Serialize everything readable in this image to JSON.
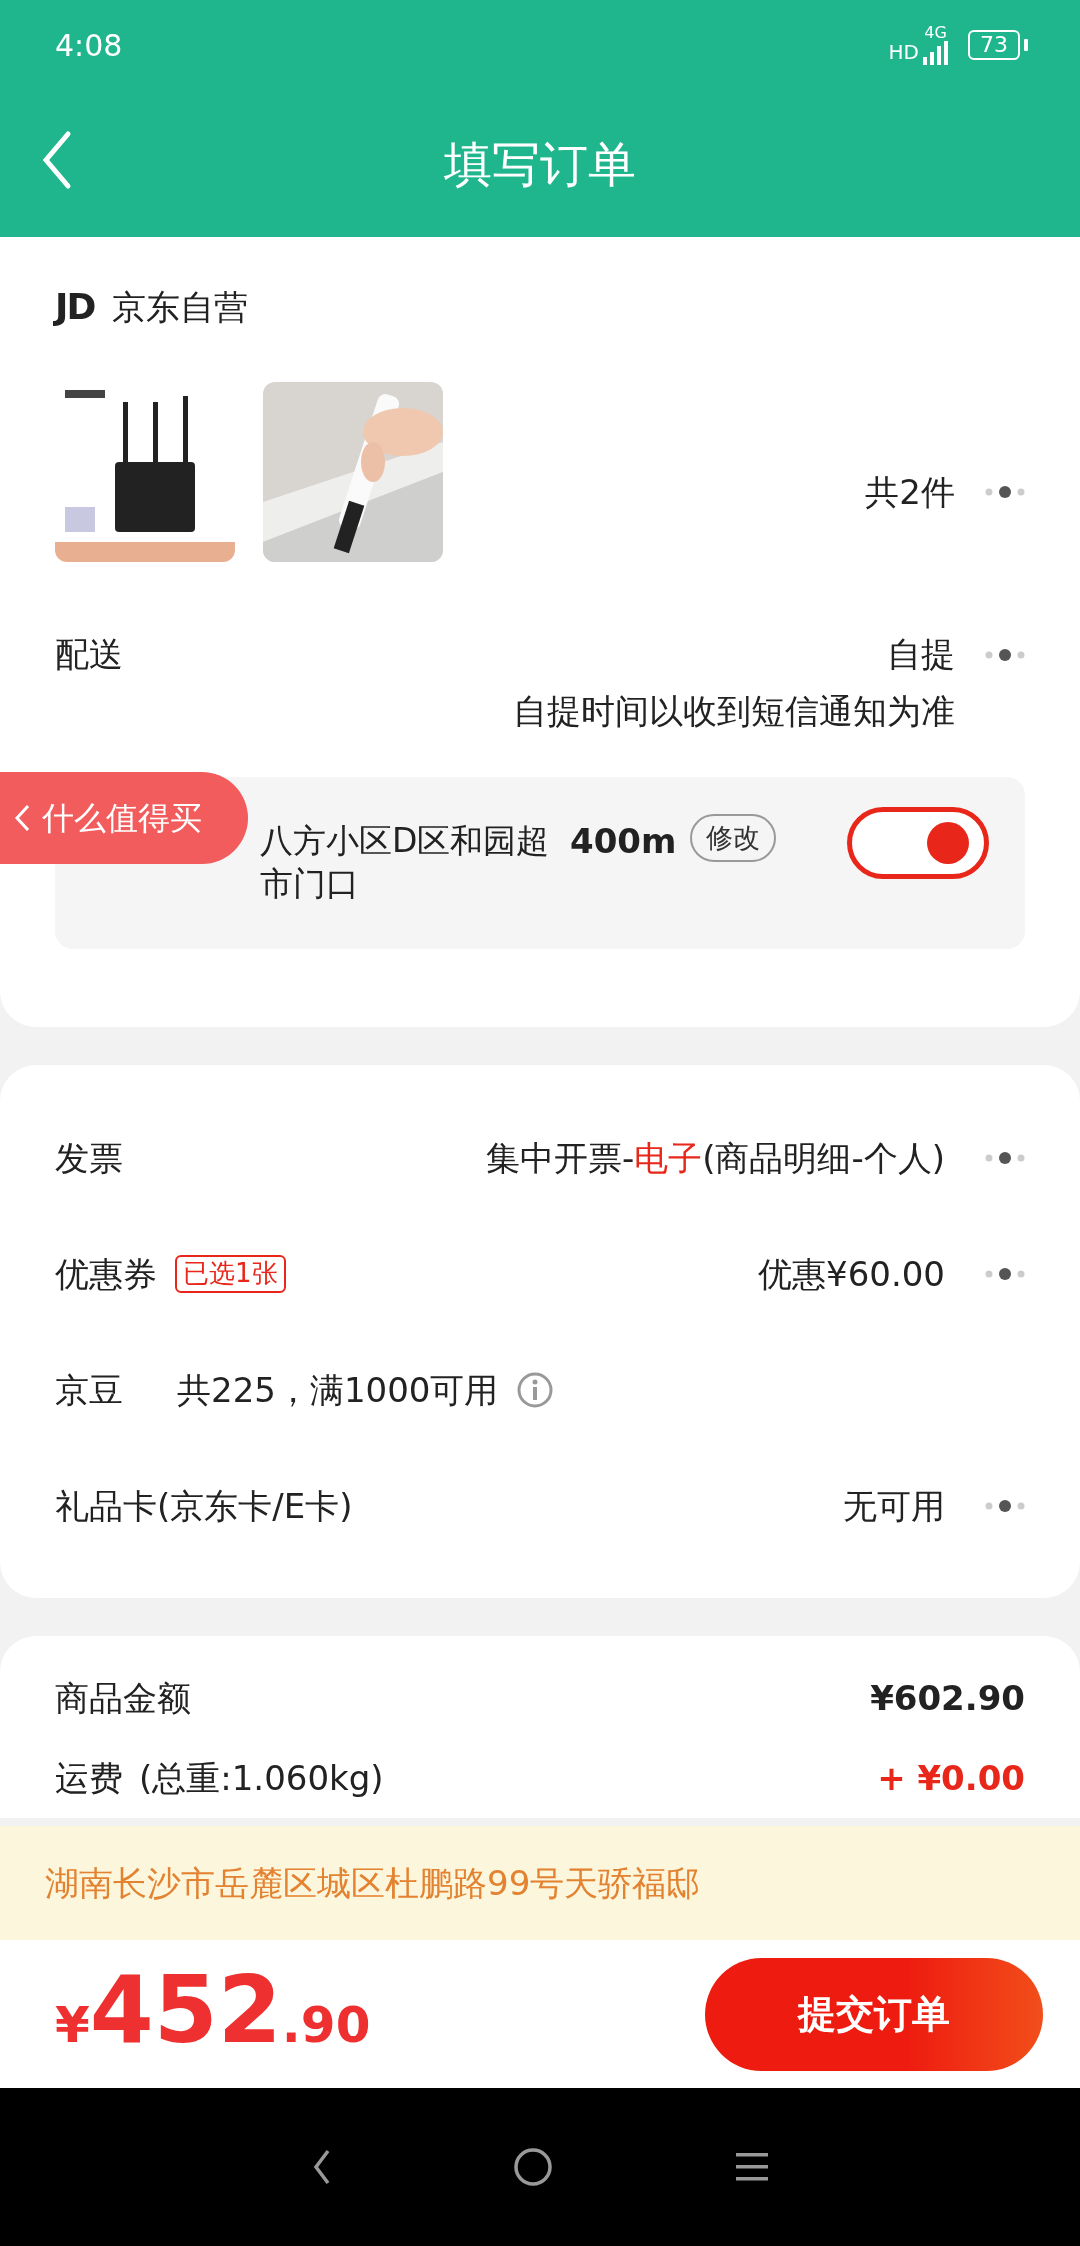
{
  "status_bar": {
    "time": "4:08",
    "network": "HD",
    "signal_type": "4G",
    "battery": "73"
  },
  "header": {
    "title": "填写订单"
  },
  "store": {
    "logo": "JD",
    "name": "京东自营"
  },
  "products": {
    "count": "共2件"
  },
  "delivery": {
    "label": "配送",
    "value": "自提",
    "note": "自提时间以收到短信通知为准",
    "pickup": {
      "address": "八方小区D区和园超市门口",
      "distance": "400m",
      "edit": "修改",
      "on": true
    }
  },
  "floating_badge": {
    "label": "什么值得买"
  },
  "options": [
    {
      "kind": "select",
      "label": "发票",
      "value_parts": [
        {
          "text": "集中开票-",
          "highlight": false
        },
        {
          "text": "电子",
          "highlight": true
        },
        {
          "text": "(商品明细-个人)",
          "highlight": false
        }
      ]
    },
    {
      "kind": "select",
      "label": "优惠券",
      "tag": "已选1张",
      "value_parts": [
        {
          "text": "优惠¥60.00",
          "highlight": false
        }
      ]
    },
    {
      "kind": "info",
      "label": "京豆",
      "note": "共225，满1000可用"
    },
    {
      "kind": "select",
      "label": "礼品卡(京东卡/E卡)",
      "value_parts": [
        {
          "text": "无可用",
          "highlight": false
        }
      ]
    }
  ],
  "summary": [
    {
      "kind": "plain",
      "label": "商品金额",
      "value": "¥602.90"
    },
    {
      "kind": "charge",
      "label": "运费",
      "note": "(总重:1.060kg)",
      "value": "+ ¥0.00"
    }
  ],
  "address_banner": "湖南长沙市岳麓区城区杜鹏路99号天骄福邸",
  "footer": {
    "currency": "¥",
    "price_main": "452",
    "price_decimal": ".90",
    "submit": "提交订单"
  }
}
